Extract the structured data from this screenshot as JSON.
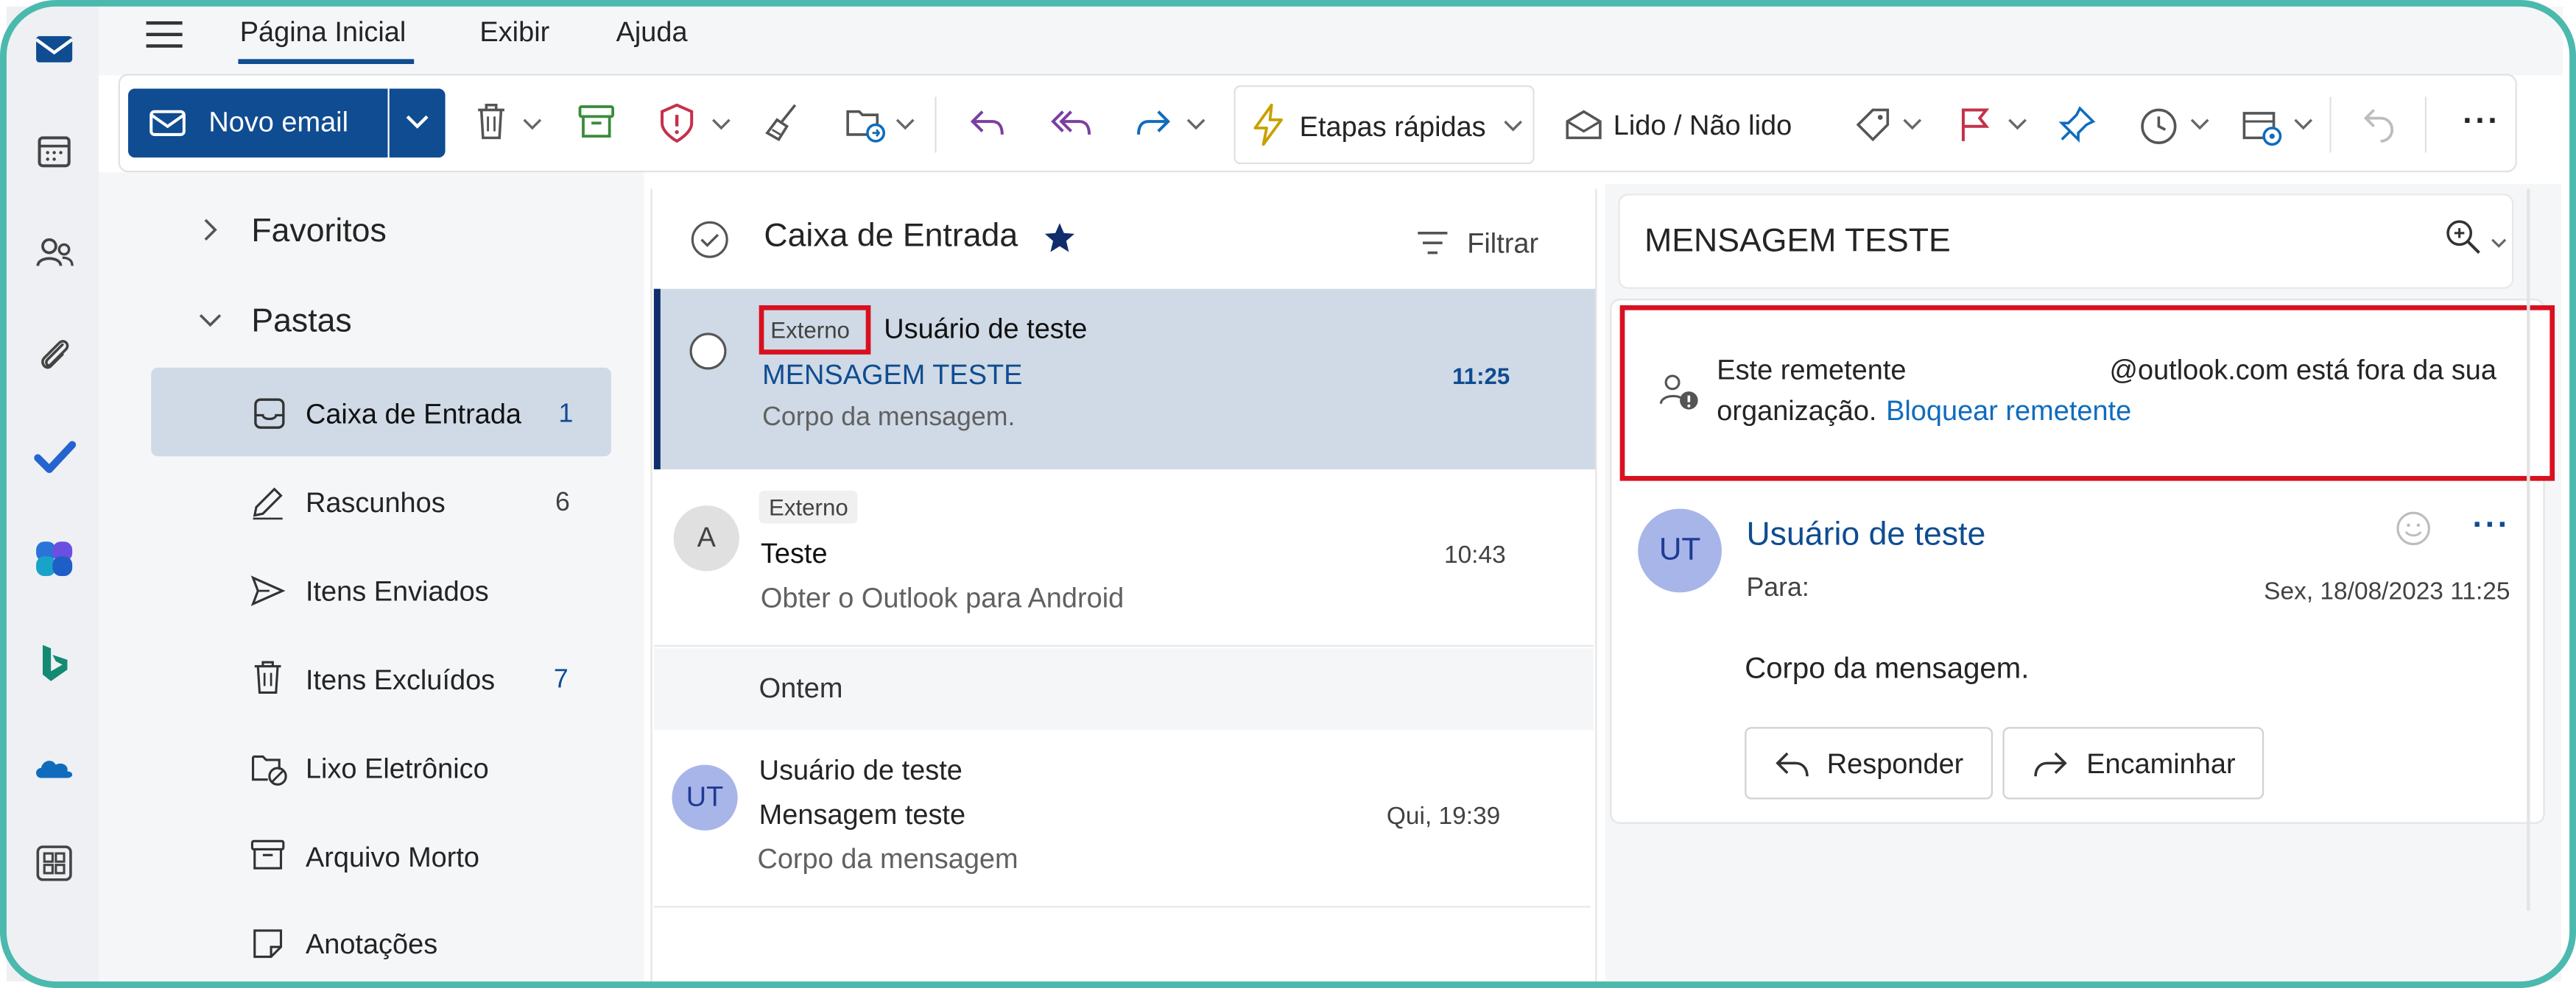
{
  "topbar": {
    "tabs": [
      {
        "label": "Página Inicial",
        "active": true
      },
      {
        "label": "Exibir"
      },
      {
        "label": "Ajuda"
      }
    ]
  },
  "ribbon": {
    "new_email_label": "Novo email",
    "quick_steps_label": "Etapas rápidas",
    "read_unread_label": "Lido / Não lido",
    "more_label": "···"
  },
  "sidebar": {
    "favorites_label": "Favoritos",
    "folders_label": "Pastas",
    "items": [
      {
        "label": "Caixa de Entrada",
        "count": "1",
        "selected": true
      },
      {
        "label": "Rascunhos",
        "count": "6"
      },
      {
        "label": "Itens Enviados",
        "count": ""
      },
      {
        "label": "Itens Excluídos",
        "count": "7"
      },
      {
        "label": "Lixo Eletrônico",
        "count": ""
      },
      {
        "label": "Arquivo Morto",
        "count": ""
      },
      {
        "label": "Anotações",
        "count": ""
      }
    ]
  },
  "list": {
    "title": "Caixa de Entrada",
    "filter_label": "Filtrar",
    "messages": [
      {
        "badge": "Externo",
        "sender": "Usuário de teste",
        "subject": "MENSAGEM TESTE",
        "preview": "Corpo da mensagem.",
        "time": "11:25"
      },
      {
        "avatar": "A",
        "badge": "Externo",
        "sender": "Teste",
        "preview": "Obter o Outlook para Android",
        "time": "10:43"
      },
      {
        "avatar": "UT",
        "sender": "Usuário de teste",
        "subject": "Mensagem teste",
        "preview": "Corpo da mensagem",
        "time": "Qui, 19:39"
      }
    ],
    "group_yesterday": "Ontem"
  },
  "reading": {
    "subject": "MENSAGEM TESTE",
    "warning_part1": "Este remetente",
    "warning_part2": "@outlook.com está fora da sua",
    "warning_part3": "organização.",
    "block_link": "Bloquear remetente",
    "avatar": "UT",
    "sender": "Usuário de teste",
    "to_label": "Para:",
    "date": "Sex, 18/08/2023 11:25",
    "body": "Corpo da mensagem.",
    "reply_label": "Responder",
    "forward_label": "Encaminhar",
    "more_label": "···"
  },
  "colors": {
    "accent": "#0f4c91",
    "highlight_box": "#d8101f",
    "frame": "#4bb9ad",
    "selected_row": "#cfdae6"
  }
}
